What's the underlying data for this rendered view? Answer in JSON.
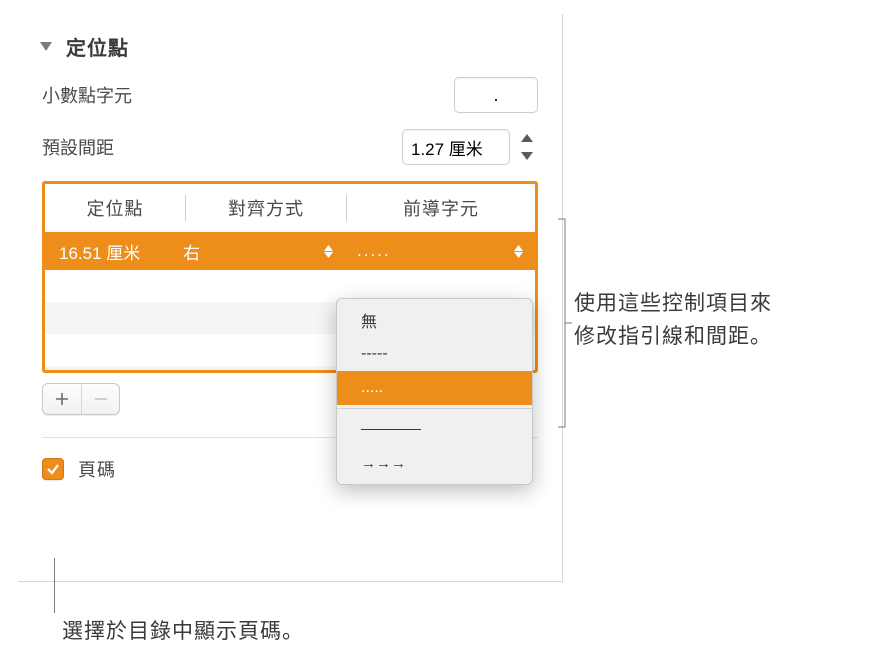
{
  "section": {
    "title": "定位點"
  },
  "decimal": {
    "label": "小數點字元",
    "value": "."
  },
  "spacing": {
    "label": "預設間距",
    "value": "1.27 厘米"
  },
  "table": {
    "headers": {
      "pos": "定位點",
      "align": "對齊方式",
      "leader": "前導字元"
    },
    "row": {
      "pos": "16.51 厘米",
      "align": "右",
      "leader": "....."
    }
  },
  "dropdown": {
    "none": "無",
    "dashes": "-----",
    "dots": ".....",
    "arrows": "→→→"
  },
  "checkbox": {
    "label": "頁碼"
  },
  "callouts": {
    "right_line1": "使用這些控制項目來",
    "right_line2": "修改指引線和間距。",
    "bottom": "選擇於目錄中顯示頁碼。"
  }
}
